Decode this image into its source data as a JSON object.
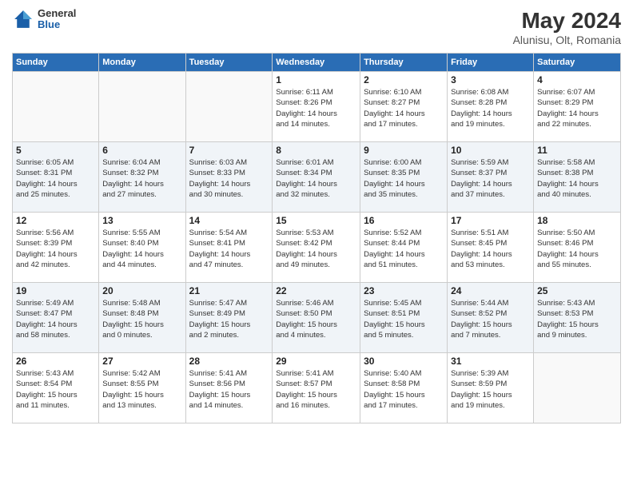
{
  "header": {
    "logo": {
      "general": "General",
      "blue": "Blue"
    },
    "title": "May 2024",
    "location": "Alunisu, Olt, Romania"
  },
  "weekdays": [
    "Sunday",
    "Monday",
    "Tuesday",
    "Wednesday",
    "Thursday",
    "Friday",
    "Saturday"
  ],
  "weeks": [
    [
      {
        "day": "",
        "info": ""
      },
      {
        "day": "",
        "info": ""
      },
      {
        "day": "",
        "info": ""
      },
      {
        "day": "1",
        "info": "Sunrise: 6:11 AM\nSunset: 8:26 PM\nDaylight: 14 hours\nand 14 minutes."
      },
      {
        "day": "2",
        "info": "Sunrise: 6:10 AM\nSunset: 8:27 PM\nDaylight: 14 hours\nand 17 minutes."
      },
      {
        "day": "3",
        "info": "Sunrise: 6:08 AM\nSunset: 8:28 PM\nDaylight: 14 hours\nand 19 minutes."
      },
      {
        "day": "4",
        "info": "Sunrise: 6:07 AM\nSunset: 8:29 PM\nDaylight: 14 hours\nand 22 minutes."
      }
    ],
    [
      {
        "day": "5",
        "info": "Sunrise: 6:05 AM\nSunset: 8:31 PM\nDaylight: 14 hours\nand 25 minutes."
      },
      {
        "day": "6",
        "info": "Sunrise: 6:04 AM\nSunset: 8:32 PM\nDaylight: 14 hours\nand 27 minutes."
      },
      {
        "day": "7",
        "info": "Sunrise: 6:03 AM\nSunset: 8:33 PM\nDaylight: 14 hours\nand 30 minutes."
      },
      {
        "day": "8",
        "info": "Sunrise: 6:01 AM\nSunset: 8:34 PM\nDaylight: 14 hours\nand 32 minutes."
      },
      {
        "day": "9",
        "info": "Sunrise: 6:00 AM\nSunset: 8:35 PM\nDaylight: 14 hours\nand 35 minutes."
      },
      {
        "day": "10",
        "info": "Sunrise: 5:59 AM\nSunset: 8:37 PM\nDaylight: 14 hours\nand 37 minutes."
      },
      {
        "day": "11",
        "info": "Sunrise: 5:58 AM\nSunset: 8:38 PM\nDaylight: 14 hours\nand 40 minutes."
      }
    ],
    [
      {
        "day": "12",
        "info": "Sunrise: 5:56 AM\nSunset: 8:39 PM\nDaylight: 14 hours\nand 42 minutes."
      },
      {
        "day": "13",
        "info": "Sunrise: 5:55 AM\nSunset: 8:40 PM\nDaylight: 14 hours\nand 44 minutes."
      },
      {
        "day": "14",
        "info": "Sunrise: 5:54 AM\nSunset: 8:41 PM\nDaylight: 14 hours\nand 47 minutes."
      },
      {
        "day": "15",
        "info": "Sunrise: 5:53 AM\nSunset: 8:42 PM\nDaylight: 14 hours\nand 49 minutes."
      },
      {
        "day": "16",
        "info": "Sunrise: 5:52 AM\nSunset: 8:44 PM\nDaylight: 14 hours\nand 51 minutes."
      },
      {
        "day": "17",
        "info": "Sunrise: 5:51 AM\nSunset: 8:45 PM\nDaylight: 14 hours\nand 53 minutes."
      },
      {
        "day": "18",
        "info": "Sunrise: 5:50 AM\nSunset: 8:46 PM\nDaylight: 14 hours\nand 55 minutes."
      }
    ],
    [
      {
        "day": "19",
        "info": "Sunrise: 5:49 AM\nSunset: 8:47 PM\nDaylight: 14 hours\nand 58 minutes."
      },
      {
        "day": "20",
        "info": "Sunrise: 5:48 AM\nSunset: 8:48 PM\nDaylight: 15 hours\nand 0 minutes."
      },
      {
        "day": "21",
        "info": "Sunrise: 5:47 AM\nSunset: 8:49 PM\nDaylight: 15 hours\nand 2 minutes."
      },
      {
        "day": "22",
        "info": "Sunrise: 5:46 AM\nSunset: 8:50 PM\nDaylight: 15 hours\nand 4 minutes."
      },
      {
        "day": "23",
        "info": "Sunrise: 5:45 AM\nSunset: 8:51 PM\nDaylight: 15 hours\nand 5 minutes."
      },
      {
        "day": "24",
        "info": "Sunrise: 5:44 AM\nSunset: 8:52 PM\nDaylight: 15 hours\nand 7 minutes."
      },
      {
        "day": "25",
        "info": "Sunrise: 5:43 AM\nSunset: 8:53 PM\nDaylight: 15 hours\nand 9 minutes."
      }
    ],
    [
      {
        "day": "26",
        "info": "Sunrise: 5:43 AM\nSunset: 8:54 PM\nDaylight: 15 hours\nand 11 minutes."
      },
      {
        "day": "27",
        "info": "Sunrise: 5:42 AM\nSunset: 8:55 PM\nDaylight: 15 hours\nand 13 minutes."
      },
      {
        "day": "28",
        "info": "Sunrise: 5:41 AM\nSunset: 8:56 PM\nDaylight: 15 hours\nand 14 minutes."
      },
      {
        "day": "29",
        "info": "Sunrise: 5:41 AM\nSunset: 8:57 PM\nDaylight: 15 hours\nand 16 minutes."
      },
      {
        "day": "30",
        "info": "Sunrise: 5:40 AM\nSunset: 8:58 PM\nDaylight: 15 hours\nand 17 minutes."
      },
      {
        "day": "31",
        "info": "Sunrise: 5:39 AM\nSunset: 8:59 PM\nDaylight: 15 hours\nand 19 minutes."
      },
      {
        "day": "",
        "info": ""
      }
    ]
  ]
}
